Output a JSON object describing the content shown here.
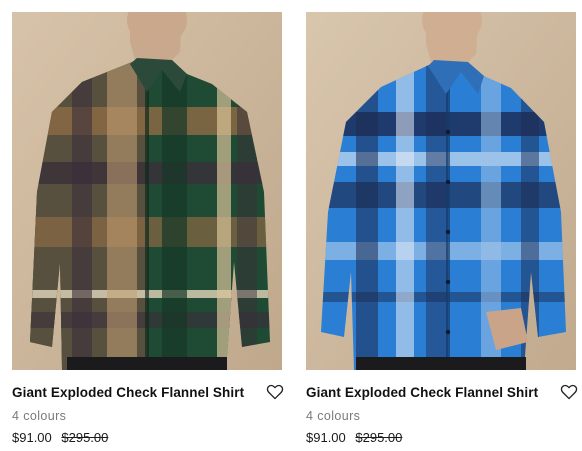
{
  "products": [
    {
      "name": "Giant Exploded Check Flannel Shirt",
      "colours": "4 colours",
      "price": "$91.00",
      "original_price": "$295.00",
      "image_icon": "plaid-shirt-green-image",
      "palette": [
        "#1f4a33",
        "#8a6a45",
        "#3a2f3a",
        "#d9c39a"
      ]
    },
    {
      "name": "Giant Exploded Check Flannel Shirt",
      "colours": "4 colours",
      "price": "$91.00",
      "original_price": "$295.00",
      "image_icon": "plaid-shirt-blue-image",
      "palette": [
        "#2a7fd4",
        "#1d2b52",
        "#9fc3ea",
        "#e7eef7"
      ]
    }
  ],
  "icons": {
    "wishlist": "heart-outline-icon"
  }
}
